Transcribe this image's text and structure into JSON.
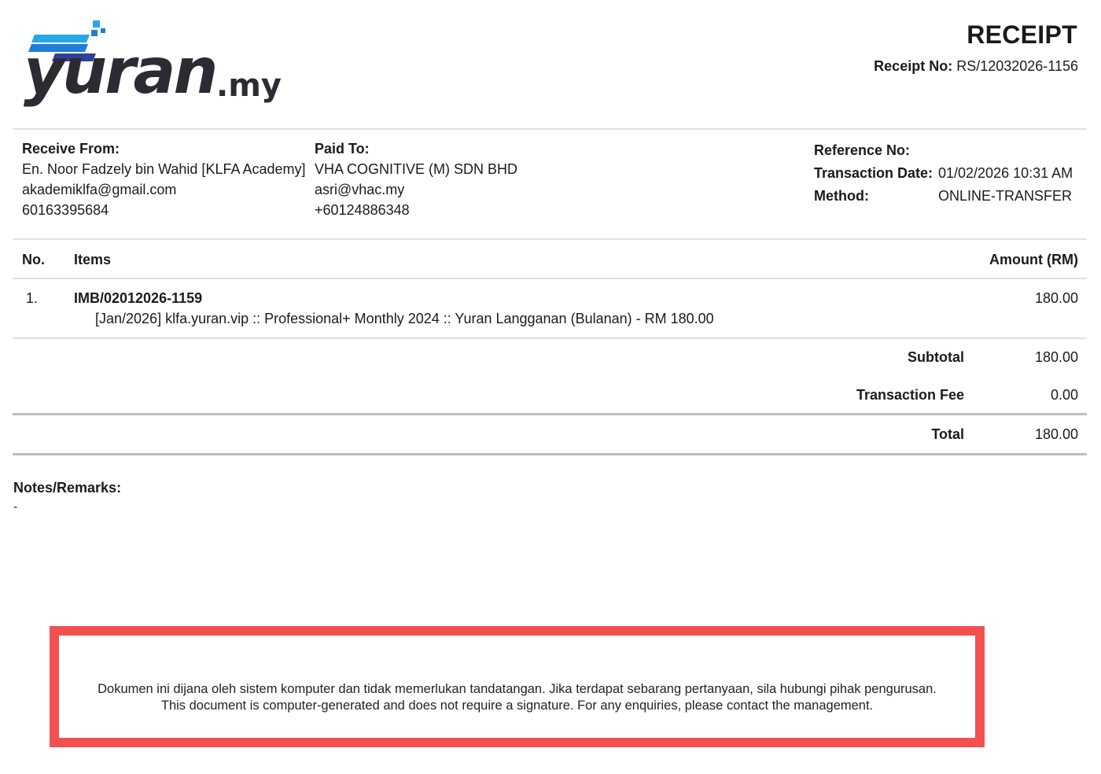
{
  "logo": {
    "wordmark": "yuran",
    "suffix": ".my"
  },
  "receipt": {
    "title": "RECEIPT",
    "receipt_no_label": "Receipt No:",
    "receipt_no": "RS/12032026-1156"
  },
  "receive_from": {
    "label": "Receive From:",
    "name": "En. Noor Fadzely bin Wahid [KLFA Academy]",
    "email": "akademiklfa@gmail.com",
    "phone": "60163395684"
  },
  "paid_to": {
    "label": "Paid To:",
    "name": "VHA COGNITIVE (M) SDN BHD",
    "email": "asri@vhac.my",
    "phone": "+60124886348"
  },
  "meta": {
    "reference_label": "Reference No:",
    "reference_value": "",
    "date_label": "Transaction Date:",
    "date_value": "01/02/2026 10:31 AM",
    "method_label": "Method:",
    "method_value": "ONLINE-TRANSFER"
  },
  "table": {
    "col_no": "No.",
    "col_items": "Items",
    "col_amount": "Amount (RM)",
    "rows": [
      {
        "no": "1.",
        "code": "IMB/02012026-1159",
        "description": "[Jan/2026] klfa.yuran.vip :: Professional+ Monthly 2024 :: Yuran Langganan (Bulanan) - RM 180.00",
        "amount": "180.00"
      }
    ]
  },
  "summary": {
    "subtotal_label": "Subtotal",
    "subtotal": "180.00",
    "fee_label": "Transaction Fee",
    "fee": "0.00",
    "total_label": "Total",
    "total": "180.00"
  },
  "notes": {
    "label": "Notes/Remarks:",
    "text": "-"
  },
  "notice": {
    "line_ms": "Dokumen ini dijana oleh sistem komputer dan tidak memerlukan tandatangan. Jika terdapat sebarang pertanyaan, sila hubungi pihak pengurusan.",
    "line_en": "This document is computer-generated and does not require a signature. For any enquiries, please contact the management."
  },
  "colors": {
    "logo_dark": "#2b2b33",
    "logo_blue": "#1f7fd6",
    "logo_light_blue": "#25a8e8",
    "logo_navy": "#2f3f9a",
    "notice_border": "#f45050"
  }
}
